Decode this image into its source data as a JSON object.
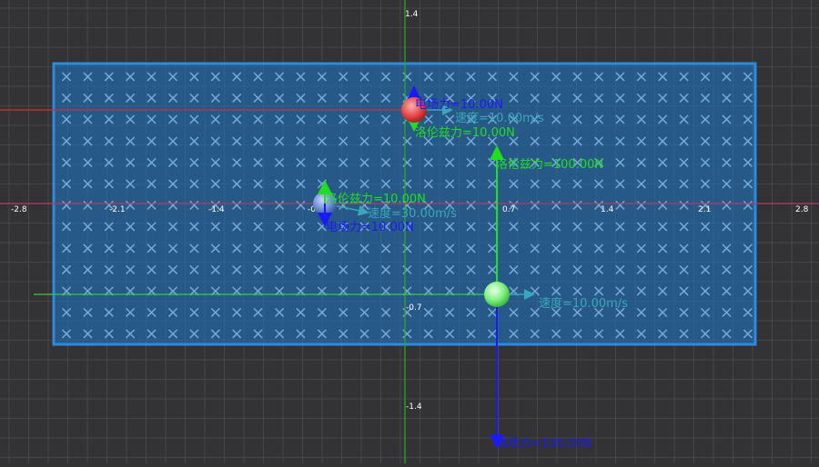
{
  "axis_ticks": {
    "x": [
      "-2.8",
      "-2.1",
      "-1.4",
      "-0",
      "0.7",
      "1.4",
      "2.1",
      "2.8"
    ],
    "y": [
      "1.4",
      "-0.7",
      "-1.4"
    ]
  },
  "particles": [
    {
      "id": "red",
      "color": "#e84a4a",
      "velocity_label": "速度=10.00m/s",
      "electric_label": "电场力=10.00N",
      "lorentz_label": "洛伦兹力=10.00N"
    },
    {
      "id": "blue",
      "color": "#6f8fd8",
      "velocity_label": "速度=30.00m/s",
      "electric_label": "电场力=10.00N",
      "lorentz_label": "洛伦兹力=10.00N"
    },
    {
      "id": "green",
      "color": "#7ff07f",
      "velocity_label": "速度=10.00m/s",
      "electric_label": "电场力=100.00N",
      "lorentz_label": "洛伦兹力=100.00N"
    }
  ],
  "colors": {
    "background": "#333336",
    "field_fill": "#1e78c8",
    "field_stroke": "#2a8be0",
    "electric_force": "#1a1aff",
    "lorentz_force": "#22dd22",
    "velocity": "#3aa6b9",
    "axis_y": "#2ea82e",
    "axis_x": "#b33a6a"
  },
  "field": {
    "symbol": "×"
  }
}
